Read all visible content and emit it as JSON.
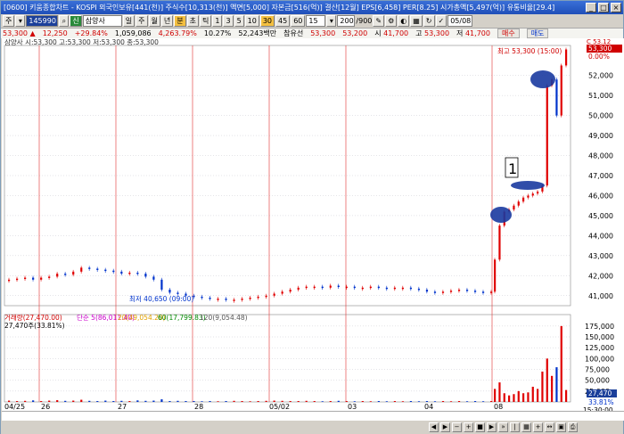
{
  "window": {
    "title": "[0600] 키움종합차트 - KOSPI 외국인보유[441(천)] 주식수[10,313(천)] 액면[5,000] 자본금[516(억)] 결산[12월] EPS[6,458] PER[8.25] 시가총액[5,497(억)] 유통비율[29.4]"
  },
  "toolbar": {
    "mode_btn": "주",
    "sep_btn": "▾",
    "code": "145990",
    "stock_icon": "신",
    "stock_name": "삼양사",
    "period_buttons": [
      "일",
      "주",
      "월",
      "년",
      "분",
      "초",
      "틱",
      "1",
      "3",
      "5",
      "10",
      "30",
      "45",
      "60",
      "15"
    ],
    "count": "200",
    "count_max": "/900",
    "date": "05/08"
  },
  "infobar": {
    "price": "53,300",
    "change": "12,250",
    "change_pct": "+29.84%",
    "volume": "1,059,086",
    "amount": "4,263.79%",
    "rate": "10.27%",
    "trade_value": "52,243백만",
    "ref_label": "참유선",
    "ref_value": "53,300",
    "v2": "53,200",
    "open_label": "시",
    "open": "41,700",
    "high_label": "고",
    "high": "53,300",
    "low_label": "저",
    "low": "41,700",
    "buy_label": "매수",
    "sell_label": "매도"
  },
  "chart_legend": {
    "price_legend": "삼양사 시:53,300 고:53,300 저:53,300 종:53,300",
    "high_note": "최고 53,300 (15:00)",
    "low_note": "최저 40,650 (09:00)",
    "annotation_box": "1",
    "current_box": "53,300",
    "current_pct": "0.00%",
    "top_right_tag": "C 53.12",
    "volume_legend_1": "거래량(27,470.00)",
    "volume_legend_2": "단순 5(86,011.40)",
    "volume_legend_3": "20(49,054.20)",
    "volume_legend_4": "60(17,799.83)",
    "volume_legend_5": "120(9,054.48)",
    "volume_sub": "27,470주(33.81%)",
    "volume_current": "27,470",
    "volume_pct": "33.81%",
    "time_label": "15:30:00"
  },
  "chart_data": {
    "type": "line",
    "x_labels": [
      "04/25",
      "26",
      "27",
      "28",
      "05/02",
      "03",
      "04",
      "08"
    ],
    "y_ticks": [
      "52,000",
      "51,000",
      "50,000",
      "49,000",
      "48,000",
      "47,000",
      "46,000",
      "45,000",
      "44,000",
      "43,000",
      "42,000",
      "41,000"
    ],
    "ylim": [
      40500,
      53500
    ],
    "vol_ticks": [
      "175,000",
      "150,000",
      "125,000",
      "100,000",
      "75,000",
      "50,000",
      "25,000"
    ],
    "vol_ylim": [
      0,
      185000
    ],
    "series": [
      {
        "values": [
          41800,
          41850,
          41900,
          41800,
          41900,
          41950,
          42100,
          42050,
          42200,
          42400,
          42350,
          42300,
          42250,
          42200,
          42100,
          42150,
          42100,
          41950,
          41800,
          41300,
          41150,
          41100,
          41000,
          40950,
          40900,
          40850,
          40850,
          40800,
          40800,
          40850,
          40900,
          40950,
          41000,
          41100,
          41200,
          41300,
          41400,
          41450,
          41450,
          41400,
          41500,
          41450,
          41450,
          41400,
          41400,
          41450,
          41400,
          41350,
          41400,
          41400,
          41350,
          41300,
          41200,
          41150,
          41200,
          41250,
          41300,
          41250,
          41200,
          41150,
          41200,
          42800,
          44500,
          45200,
          45300,
          45500,
          45700,
          45900,
          46000,
          46100,
          46200,
          46500,
          51500,
          51800,
          50000,
          52500,
          53300
        ]
      }
    ],
    "volume": [
      3000,
      2000,
      2500,
      3500,
      2000,
      3000,
      4000,
      2500,
      3000,
      5000,
      2500,
      2000,
      3000,
      2000,
      2500,
      2000,
      3500,
      2500,
      3000,
      6000,
      2000,
      2500,
      2000,
      2000,
      1500,
      2000,
      1500,
      2000,
      2500,
      2000,
      1500,
      2000,
      2500,
      3000,
      2500,
      2000,
      2000,
      2500,
      2000,
      1500,
      2000,
      2500,
      2000,
      1500,
      2000,
      1500,
      2000,
      1500,
      2000,
      1500,
      2000,
      1500,
      2000,
      1500,
      2000,
      1500,
      2000,
      1500,
      2000,
      1500,
      2000,
      30000,
      45000,
      20000,
      15000,
      18000,
      25000,
      20000,
      22000,
      35000,
      30000,
      70000,
      100000,
      60000,
      80000,
      175000,
      27470
    ]
  },
  "colors": {
    "up": "#e00000",
    "down": "#0033cc",
    "vline": "#e03030",
    "grid": "#c8c8d0"
  }
}
